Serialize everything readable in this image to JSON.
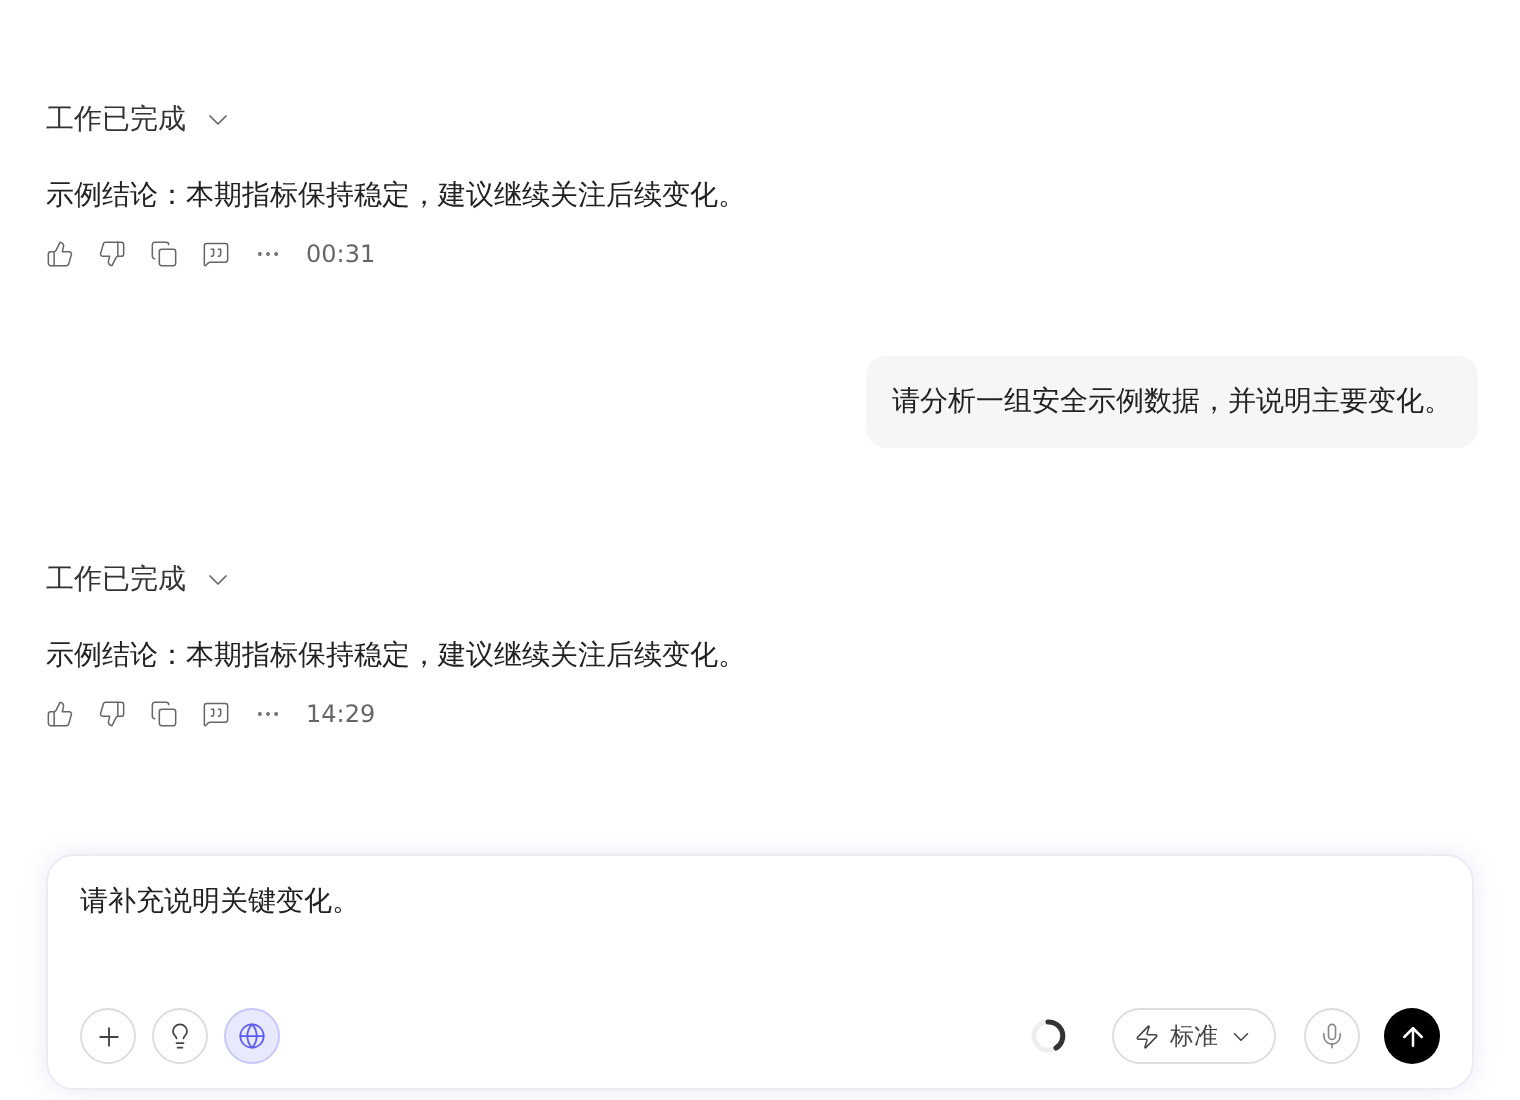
{
  "messages": [
    {
      "kind": "assistant",
      "status": "工作已完成",
      "expanded": false,
      "text": "示例结论：本期指标保持稳定，建议继续关注后续变化。",
      "time": "00:31"
    },
    {
      "kind": "user",
      "text": "请分析一组安全示例数据，并说明主要变化。"
    },
    {
      "kind": "assistant",
      "status": "工作已完成",
      "expanded": false,
      "text": "示例结论：本期指标保持稳定，建议继续关注后续变化。",
      "time": "14:29"
    }
  ],
  "composer": {
    "value": "请补充说明关键变化。",
    "web_search": {
      "on": true
    },
    "mode": "标准"
  }
}
